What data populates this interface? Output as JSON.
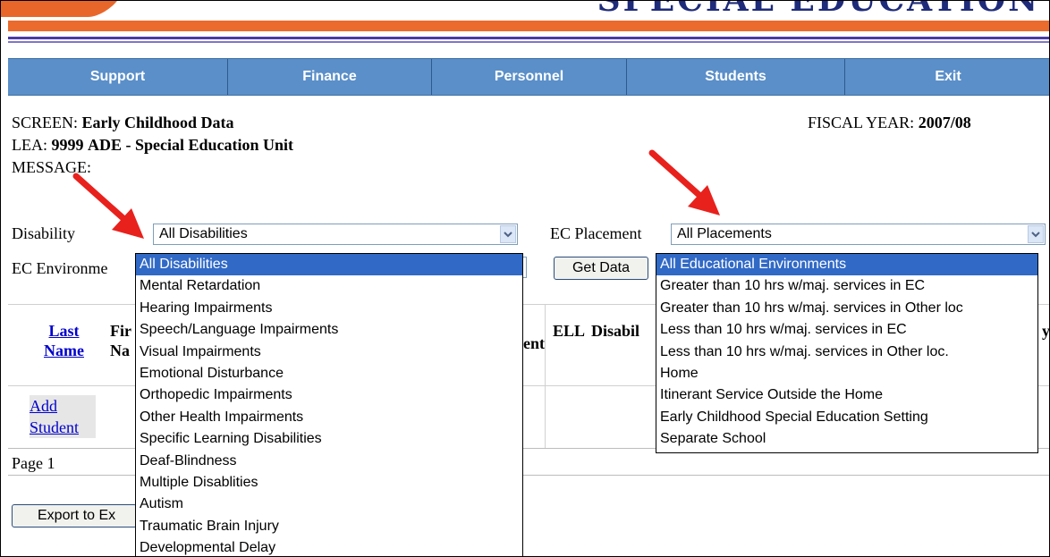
{
  "banner": {
    "title": "SPECIAL EDUCATION"
  },
  "nav": {
    "items": [
      {
        "label": "Support"
      },
      {
        "label": "Finance"
      },
      {
        "label": "Personnel"
      },
      {
        "label": "Students"
      },
      {
        "label": "Exit"
      }
    ]
  },
  "info": {
    "screen_label": "SCREEN:",
    "screen_value": "Early Childhood Data",
    "lea_label": "LEA:",
    "lea_code": "9999",
    "lea_name": "ADE - Special Education Unit",
    "message_label": "MESSAGE:",
    "fiscal_label": "FISCAL YEAR:",
    "fiscal_value": "2007/08"
  },
  "filters": {
    "disability_label": "Disability",
    "disability_selected": "All Disabilities",
    "placement_label": "EC Placement",
    "placement_selected": "All Placements",
    "environment_label": "EC Environme",
    "get_data_label": "Get Data"
  },
  "table": {
    "headers": {
      "last_name_line1": "Last",
      "last_name_line2": "Name",
      "first_name_line1": "Fir",
      "first_name_line2": "Na",
      "ent_fragment": "ent",
      "ell": "ELL",
      "disability_fragment": "Disabil",
      "y_fragment": "y"
    },
    "add_student_line1": "Add",
    "add_student_line2": "Student",
    "page_label": "Page 1"
  },
  "export": {
    "label": "Export to Ex"
  },
  "disability_options": [
    "All Disabilities",
    "Mental Retardation",
    "Hearing Impairments",
    "Speech/Language Impairments",
    "Visual Impairments",
    "Emotional Disturbance",
    "Orthopedic Impairments",
    "Other Health Impairments",
    "Specific Learning Disabilities",
    "Deaf-Blindness",
    "Multiple Disablities",
    "Autism",
    "Traumatic Brain Injury",
    "Developmental Delay"
  ],
  "environment_options": [
    "All Educational Environments",
    "Greater than 10 hrs w/maj. services in EC",
    "Greater than 10 hrs w/maj. services in Other loc",
    "Less than 10 hrs w/maj. services in EC",
    "Less than 10 hrs w/maj. services in Other loc.",
    "Home",
    "Itinerant Service Outside the Home",
    "Early Childhood Special Education Setting",
    "Separate School"
  ],
  "colors": {
    "nav_bg": "#5a8fc9",
    "selected_bg": "#3169c6",
    "arrow": "#e8211d",
    "banner_orange": "#ea6b2d"
  }
}
